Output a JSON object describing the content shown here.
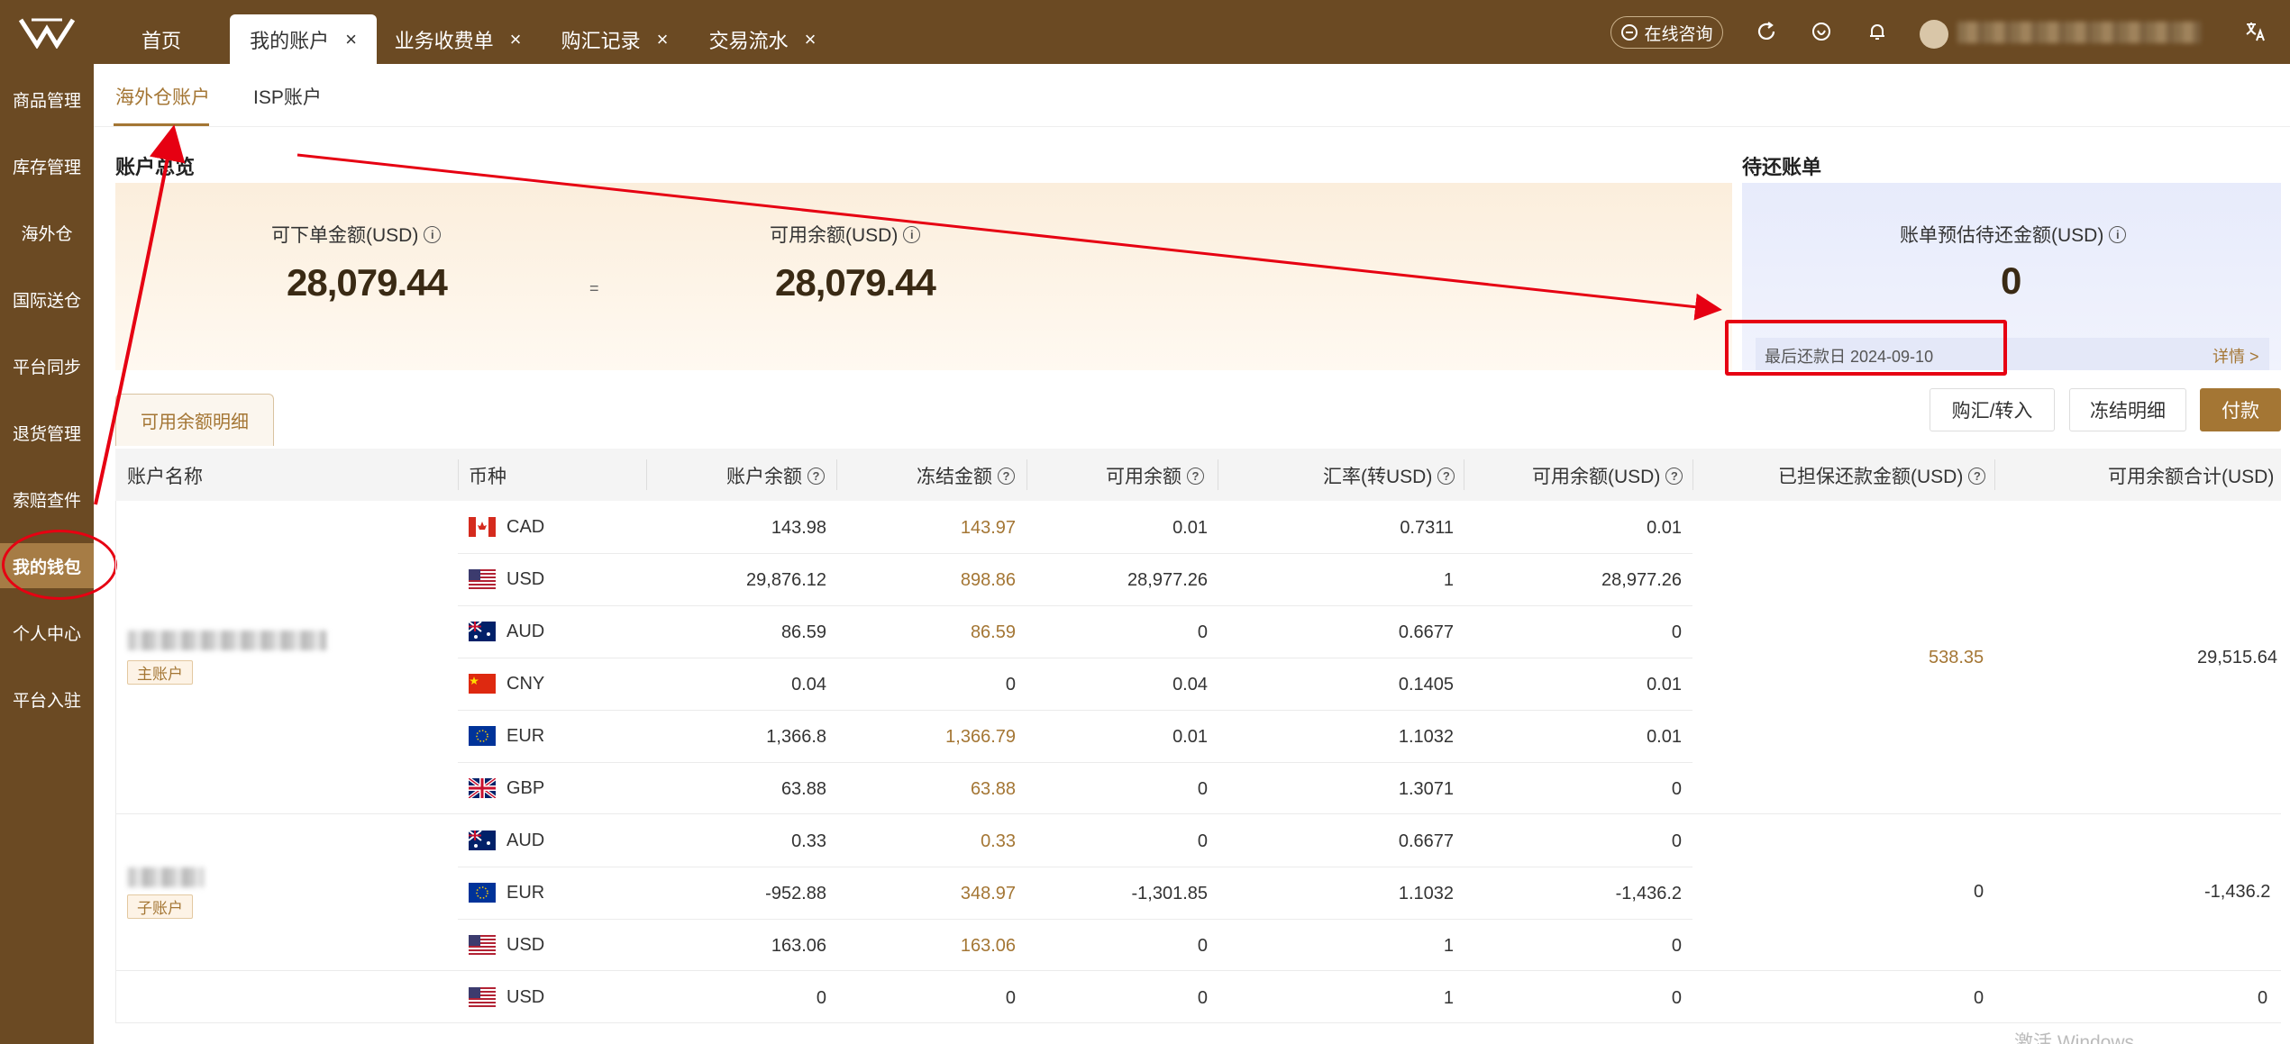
{
  "topbar": {
    "tabs": [
      {
        "label": "首页",
        "active": false,
        "closable": false
      },
      {
        "label": "我的账户",
        "active": true,
        "closable": true
      },
      {
        "label": "业务收费单",
        "active": false,
        "closable": true
      },
      {
        "label": "购汇记录",
        "active": false,
        "closable": true
      },
      {
        "label": "交易流水",
        "active": false,
        "closable": true
      }
    ],
    "close_glyph": "×",
    "consult_label": "在线咨询",
    "icons": [
      "refresh-icon",
      "heart-icon",
      "bell-icon",
      "avatar",
      "translate-icon"
    ]
  },
  "sidebar": {
    "items": [
      {
        "label": "商品管理"
      },
      {
        "label": "库存管理"
      },
      {
        "label": "海外仓"
      },
      {
        "label": "国际送仓"
      },
      {
        "label": "平台同步"
      },
      {
        "label": "退货管理"
      },
      {
        "label": "索赔查件"
      },
      {
        "label": "我的钱包",
        "active": true
      },
      {
        "label": "个人中心"
      },
      {
        "label": "平台入驻"
      }
    ]
  },
  "subtabs": [
    {
      "label": "海外仓账户",
      "active": true
    },
    {
      "label": "ISP账户",
      "active": false
    }
  ],
  "overview": {
    "title": "账户总览",
    "orderable_label": "可下单金额(USD)",
    "orderable_value": "28,079.44",
    "equals": "=",
    "available_label": "可用余额(USD)",
    "available_value": "28,079.44"
  },
  "pending": {
    "title": "待还账单",
    "label": "账单预估待还金额(USD)",
    "value": "0",
    "due_text": "最后还款日 2024-09-10",
    "detail_link": "详情 >"
  },
  "balance_tab": "可用余额明细",
  "actions": {
    "exchange": "购汇/转入",
    "frozen": "冻结明细",
    "pay": "付款"
  },
  "table": {
    "headers": [
      "账户名称",
      "币种",
      "账户余额",
      "冻结金额",
      "可用余额",
      "汇率(转USD)",
      "可用余额(USD)",
      "已担保还款金额(USD)",
      "可用余额合计(USD)"
    ],
    "groups": [
      {
        "badge": "主账户",
        "guaranteed": "538.35",
        "total": "29,515.64",
        "rows": [
          {
            "ccy": "CAD",
            "balance": "143.98",
            "frozen": "143.97",
            "available": "0.01",
            "rate": "0.7311",
            "available_usd": "0.01"
          },
          {
            "ccy": "USD",
            "balance": "29,876.12",
            "frozen": "898.86",
            "available": "28,977.26",
            "rate": "1",
            "available_usd": "28,977.26"
          },
          {
            "ccy": "AUD",
            "balance": "86.59",
            "frozen": "86.59",
            "available": "0",
            "rate": "0.6677",
            "available_usd": "0"
          },
          {
            "ccy": "CNY",
            "balance": "0.04",
            "frozen": "0",
            "available": "0.04",
            "rate": "0.1405",
            "available_usd": "0.01"
          },
          {
            "ccy": "EUR",
            "balance": "1,366.8",
            "frozen": "1,366.79",
            "available": "0.01",
            "rate": "1.1032",
            "available_usd": "0.01"
          },
          {
            "ccy": "GBP",
            "balance": "63.88",
            "frozen": "63.88",
            "available": "0",
            "rate": "1.3071",
            "available_usd": "0"
          }
        ]
      },
      {
        "badge": "子账户",
        "guaranteed": "0",
        "total": "-1,436.2",
        "rows": [
          {
            "ccy": "AUD",
            "balance": "0.33",
            "frozen": "0.33",
            "available": "0",
            "rate": "0.6677",
            "available_usd": "0"
          },
          {
            "ccy": "EUR",
            "balance": "-952.88",
            "frozen": "348.97",
            "available": "-1,301.85",
            "rate": "1.1032",
            "available_usd": "-1,436.2"
          },
          {
            "ccy": "USD",
            "balance": "163.06",
            "frozen": "163.06",
            "available": "0",
            "rate": "1",
            "available_usd": "0"
          }
        ]
      },
      {
        "badge": "",
        "guaranteed": "0",
        "total": "0",
        "rows": [
          {
            "ccy": "USD",
            "balance": "0",
            "frozen": "0",
            "available": "0",
            "rate": "1",
            "available_usd": "0"
          }
        ]
      }
    ]
  },
  "watermark": "激活 Windows",
  "colors": {
    "brand": "#6b4a23",
    "accent": "#a47634",
    "annotation": "#e60012"
  }
}
